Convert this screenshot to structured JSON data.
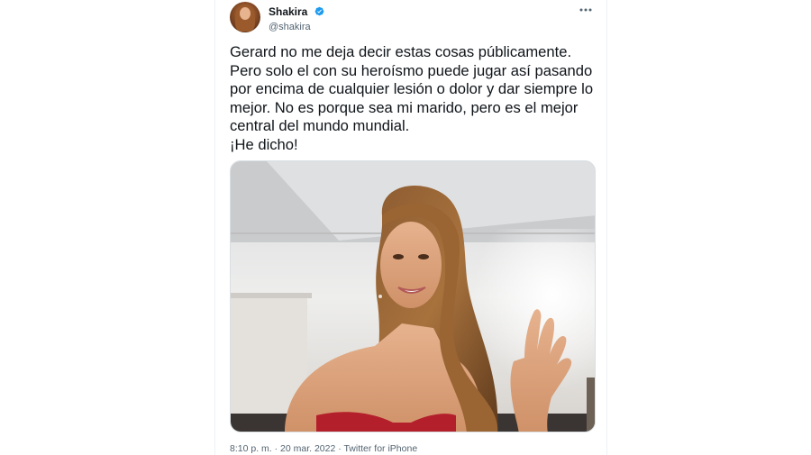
{
  "author": {
    "display_name": "Shakira",
    "handle": "@shakira",
    "verified": true
  },
  "tweet": {
    "lines": [
      "Gerard no me deja decir estas cosas públicamente.",
      "Pero solo el con su heroísmo puede jugar así pasando",
      "por encima de cualquier lesión o dolor y dar siempre lo",
      "mejor. No es porque sea mi marido, pero es el mejor",
      "central del mundo mundial.",
      "¡He dicho!"
    ]
  },
  "meta": {
    "timestamp": "8:10 p. m. · 20 mar. 2022 · Twitter for iPhone"
  },
  "icons": {
    "verified": "verified-badge-icon",
    "more": "more-options-icon"
  },
  "colors": {
    "text": "#0f1419",
    "secondary": "#536471",
    "verified": "#1d9bf0"
  }
}
